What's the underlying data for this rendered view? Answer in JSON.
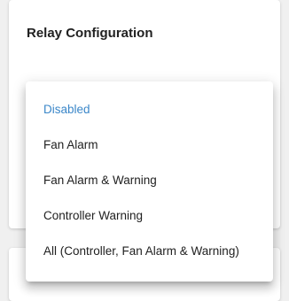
{
  "card": {
    "title": "Relay Configuration"
  },
  "dropdown": {
    "selected_index": 0,
    "options": [
      "Disabled",
      "Fan Alarm",
      "Fan Alarm & Warning",
      "Controller Warning",
      "All (Controller, Fan Alarm & Warning)"
    ]
  },
  "colors": {
    "selected": "#3b87c9",
    "text": "#212121",
    "background": "#f0f0f0",
    "surface": "#ffffff"
  }
}
